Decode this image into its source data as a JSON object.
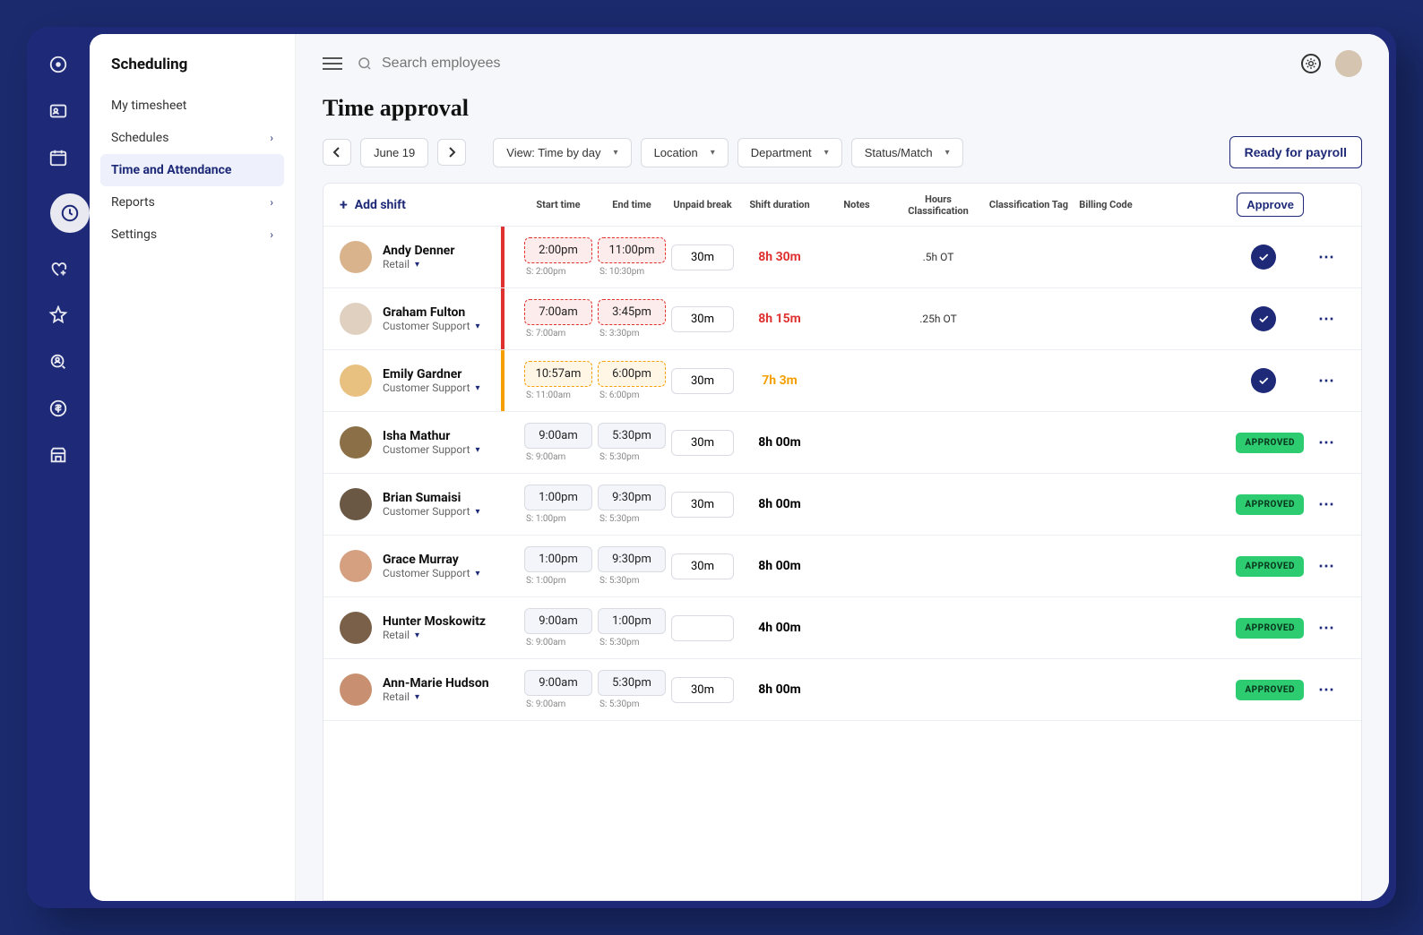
{
  "sidebar": {
    "title": "Scheduling",
    "items": [
      {
        "label": "My timesheet",
        "expandable": false
      },
      {
        "label": "Schedules",
        "expandable": true
      },
      {
        "label": "Time and Attendance",
        "expandable": false,
        "active": true
      },
      {
        "label": "Reports",
        "expandable": true
      },
      {
        "label": "Settings",
        "expandable": true
      }
    ]
  },
  "topbar": {
    "search_placeholder": "Search employees"
  },
  "page": {
    "title": "Time approval",
    "date": "June 19",
    "filters": {
      "view": "View: Time by day",
      "location": "Location",
      "department": "Department",
      "status": "Status/Match"
    },
    "ready_label": "Ready for payroll",
    "columns": {
      "add": "Add shift",
      "start": "Start time",
      "end": "End time",
      "break": "Unpaid break",
      "duration": "Shift duration",
      "notes": "Notes",
      "hours_class": "Hours Classification",
      "class_tag": "Classification Tag",
      "billing": "Billing Code",
      "approve": "Approve"
    },
    "approved_label": "APPROVED"
  },
  "rows": [
    {
      "name": "Andy Denner",
      "dept": "Retail",
      "avatar_bg": "#d9b38c",
      "start": "2:00pm",
      "s_start": "S: 2:00pm",
      "end": "11:00pm",
      "s_end": "S: 10:30pm",
      "break": "30m",
      "duration": "8h 30m",
      "dur_style": "red",
      "hours_class": ".5h OT",
      "status": "pending",
      "flag": "red"
    },
    {
      "name": "Graham Fulton",
      "dept": "Customer Support",
      "avatar_bg": "#e0d0c0",
      "start": "7:00am",
      "s_start": "S: 7:00am",
      "end": "3:45pm",
      "s_end": "S: 3:30pm",
      "break": "30m",
      "duration": "8h 15m",
      "dur_style": "red",
      "hours_class": ".25h OT",
      "status": "pending",
      "flag": "red"
    },
    {
      "name": "Emily Gardner",
      "dept": "Customer Support",
      "avatar_bg": "#e8c080",
      "start": "10:57am",
      "s_start": "S: 11:00am",
      "end": "6:00pm",
      "s_end": "S: 6:00pm",
      "break": "30m",
      "duration": "7h 3m",
      "dur_style": "orange",
      "hours_class": "",
      "status": "pending",
      "flag": "orange"
    },
    {
      "name": "Isha Mathur",
      "dept": "Customer Support",
      "avatar_bg": "#8b6f47",
      "start": "9:00am",
      "s_start": "S: 9:00am",
      "end": "5:30pm",
      "s_end": "S: 5:30pm",
      "break": "30m",
      "duration": "8h 00m",
      "dur_style": "",
      "hours_class": "",
      "status": "approved",
      "flag": ""
    },
    {
      "name": "Brian Sumaisi",
      "dept": "Customer Support",
      "avatar_bg": "#6b5844",
      "start": "1:00pm",
      "s_start": "S: 1:00pm",
      "end": "9:30pm",
      "s_end": "S: 5:30pm",
      "break": "30m",
      "duration": "8h 00m",
      "dur_style": "",
      "hours_class": "",
      "status": "approved",
      "flag": ""
    },
    {
      "name": "Grace Murray",
      "dept": "Customer Support",
      "avatar_bg": "#d4a080",
      "start": "1:00pm",
      "s_start": "S: 1:00pm",
      "end": "9:30pm",
      "s_end": "S: 5:30pm",
      "break": "30m",
      "duration": "8h 00m",
      "dur_style": "",
      "hours_class": "",
      "status": "approved",
      "flag": ""
    },
    {
      "name": "Hunter Moskowitz",
      "dept": "Retail",
      "avatar_bg": "#7a6048",
      "start": "9:00am",
      "s_start": "S: 9:00am",
      "end": "1:00pm",
      "s_end": "S: 5:30pm",
      "break": "",
      "duration": "4h 00m",
      "dur_style": "",
      "hours_class": "",
      "status": "approved",
      "flag": ""
    },
    {
      "name": "Ann-Marie Hudson",
      "dept": "Retail",
      "avatar_bg": "#c89070",
      "start": "9:00am",
      "s_start": "S: 9:00am",
      "end": "5:30pm",
      "s_end": "S: 5:30pm",
      "break": "30m",
      "duration": "8h 00m",
      "dur_style": "",
      "hours_class": "",
      "status": "approved",
      "flag": ""
    }
  ]
}
